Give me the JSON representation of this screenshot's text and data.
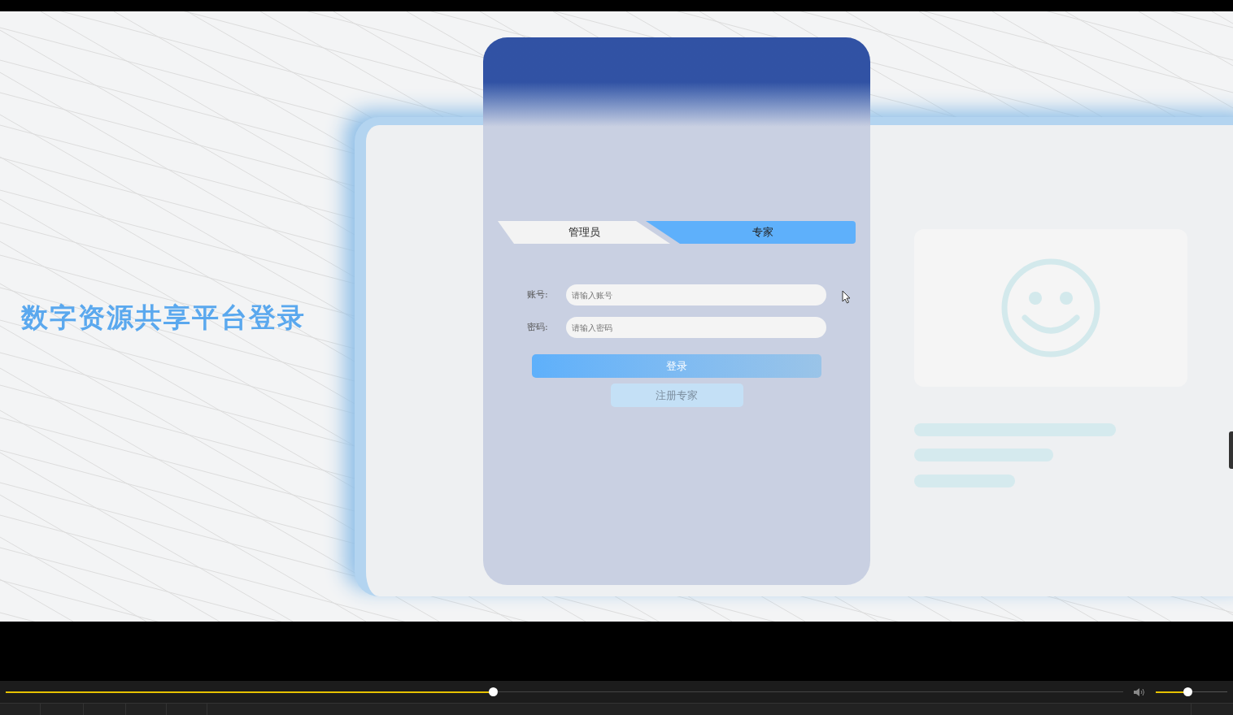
{
  "title": "数字资源共享平台登录",
  "tabs": [
    {
      "label": "管理员",
      "selected": false
    },
    {
      "label": "专家",
      "selected": true
    }
  ],
  "fields": [
    {
      "label": "账号:",
      "placeholder": "请输入账号"
    },
    {
      "label": "密码:",
      "placeholder": "请输入密码"
    }
  ],
  "login_button": "登录",
  "register_button": "注册专家",
  "player": {
    "progress": {
      "level": 0.436
    },
    "volume": {
      "level": 0.44
    }
  }
}
